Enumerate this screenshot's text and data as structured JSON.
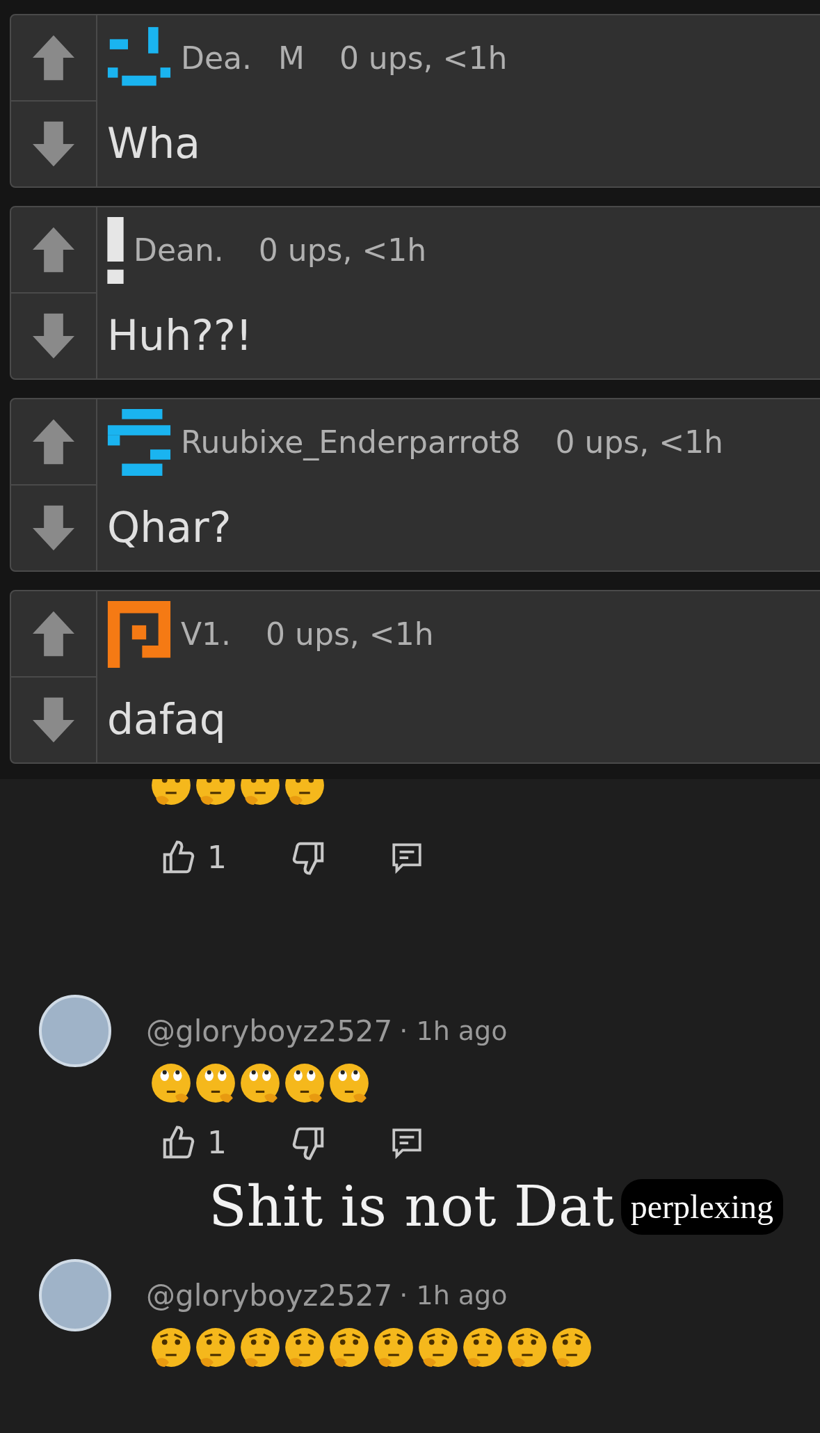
{
  "comments": [
    {
      "avatar": {
        "kind": "smile",
        "color": "#1ab4f0"
      },
      "author": "Dea.",
      "badge": "M",
      "meta": "0 ups, <1h",
      "text": "Wha"
    },
    {
      "avatar": {
        "kind": "exclaim",
        "color": "#e6e6e6"
      },
      "author": "Dean.",
      "meta": "0 ups, <1h",
      "text": "Huh??!"
    },
    {
      "avatar": {
        "kind": "bars",
        "color": "#1ab4f0"
      },
      "author": "Ruubixe_Enderparrot8",
      "meta": "0 ups, <1h",
      "text": "Qhar?"
    },
    {
      "avatar": {
        "kind": "square",
        "color": "#f57a14"
      },
      "author": "V1.",
      "meta": "0 ups, <1h",
      "text": "dafaq"
    }
  ],
  "youtube_thread": [
    {
      "kind": "tail",
      "emojis": [
        {
          "kind": "thinking"
        },
        {
          "kind": "thinking"
        },
        {
          "kind": "thinking"
        },
        {
          "kind": "thinking"
        }
      ],
      "likes": "1"
    },
    {
      "kind": "comment",
      "author": "@gloryboyz2527",
      "time": "· 1h ago",
      "emojis": [
        {
          "kind": "looking"
        },
        {
          "kind": "looking"
        },
        {
          "kind": "looking"
        },
        {
          "kind": "looking"
        },
        {
          "kind": "looking"
        }
      ],
      "likes": "1"
    },
    {
      "kind": "comment",
      "author": "@gloryboyz2527",
      "time": "· 1h ago",
      "emojis": [
        {
          "kind": "thinking"
        },
        {
          "kind": "thinking"
        },
        {
          "kind": "thinking"
        },
        {
          "kind": "thinking"
        },
        {
          "kind": "thinking"
        },
        {
          "kind": "thinking"
        },
        {
          "kind": "thinking"
        },
        {
          "kind": "thinking"
        },
        {
          "kind": "thinking"
        },
        {
          "kind": "thinking"
        }
      ]
    }
  ],
  "caption": {
    "text": "Shit is not Dat",
    "highlight": "perplexing"
  }
}
